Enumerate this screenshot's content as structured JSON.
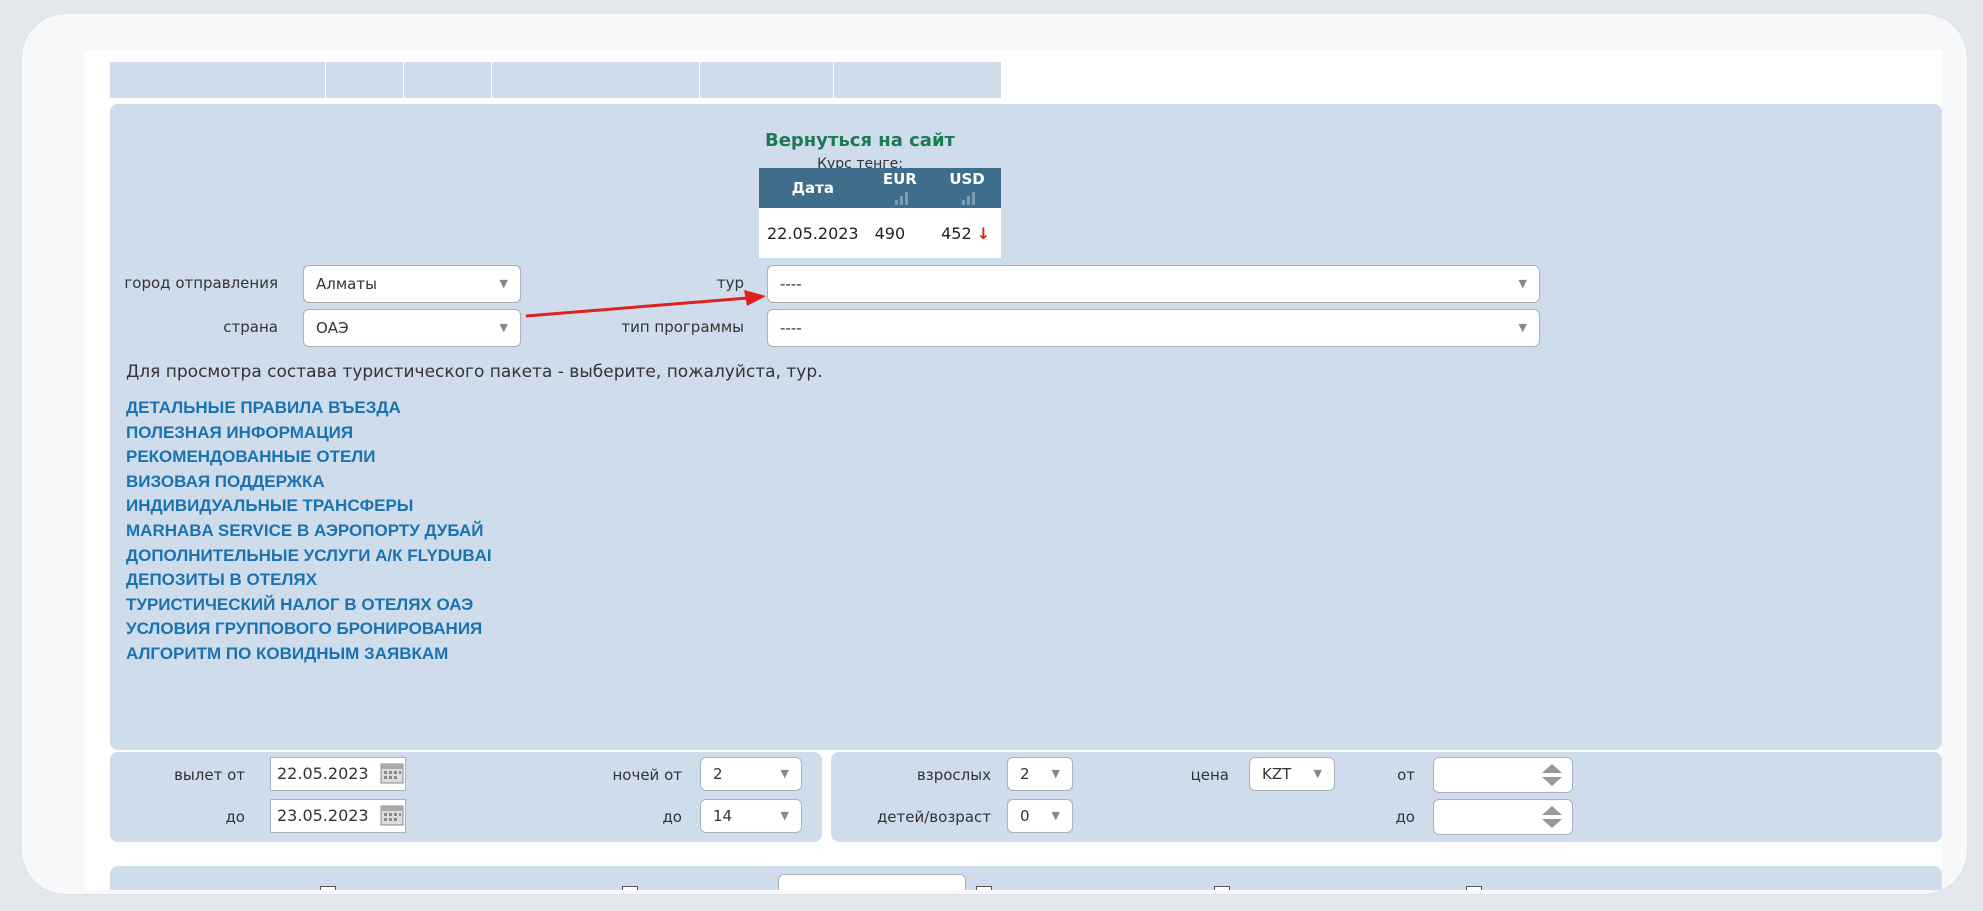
{
  "header": {
    "back_link": "Вернуться на сайт",
    "rate_caption": "Курс тенге:"
  },
  "rates": {
    "col_date": "Дата",
    "col_eur": "EUR",
    "col_usd": "USD",
    "row": {
      "date": "22.05.2023",
      "eur": "490",
      "usd": "452",
      "usd_trend": "↓"
    }
  },
  "filters": {
    "departure_city_label": "город отправления",
    "departure_city_value": "Алматы",
    "country_label": "страна",
    "country_value": "ОАЭ",
    "tour_label": "тур",
    "tour_value": "----",
    "program_type_label": "тип программы",
    "program_type_value": "----"
  },
  "info_text": "Для просмотра состава туристического пакета - выберите, пожалуйста, тур.",
  "links": [
    "ДЕТАЛЬНЫЕ ПРАВИЛА ВЪЕЗДА",
    "ПОЛЕЗНАЯ ИНФОРМАЦИЯ",
    "РЕКОМЕНДОВАННЫЕ ОТЕЛИ",
    "ВИЗОВАЯ ПОДДЕРЖКА",
    "ИНДИВИДУАЛЬНЫЕ ТРАНСФЕРЫ",
    "MARHABA SERVICE В АЭРОПОРТУ ДУБАЙ",
    "ДОПОЛНИТЕЛЬНЫЕ УСЛУГИ А/К FLYDUBAI",
    "ДЕПОЗИТЫ В ОТЕЛЯХ",
    "ТУРИСТИЧЕСКИЙ НАЛОГ В ОТЕЛЯХ ОАЭ",
    "УСЛОВИЯ ГРУППОВОГО БРОНИРОВАНИЯ",
    "АЛГОРИТМ ПО КОВИДНЫМ ЗАЯВКАМ"
  ],
  "search": {
    "departure_from_label": "вылет от",
    "departure_from_value": "22.05.2023",
    "departure_to_label": "до",
    "departure_to_value": "23.05.2023",
    "nights_from_label": "ночей от",
    "nights_from_value": "2",
    "nights_to_label": "до",
    "nights_to_value": "14",
    "adults_label": "взрослых",
    "adults_value": "2",
    "children_label": "детей/возраст",
    "children_value": "0",
    "price_label": "цена",
    "currency_value": "KZT",
    "price_from_label": "от",
    "price_to_label": "до"
  },
  "colors": {
    "panel_bg": "#cfdceb",
    "link": "#1a73b0",
    "back_link": "#1a7a52",
    "table_header": "#3f6e8c",
    "annotation_arrow": "#e02020"
  }
}
